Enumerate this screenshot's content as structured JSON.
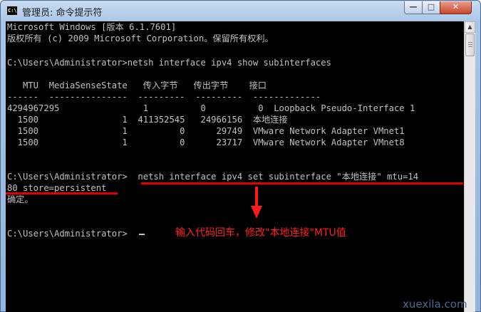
{
  "window": {
    "title": "管理员: 命令提示符",
    "icon_text": "C:\\",
    "controls": {
      "minimize": "—",
      "maximize": "□",
      "close": "✕"
    }
  },
  "console": {
    "lines": [
      "Microsoft Windows [版本 6.1.7601]",
      "版权所有 (c) 2009 Microsoft Corporation。保留所有权利。",
      "",
      "C:\\Users\\Administrator>netsh interface ipv4 show subinterfaces",
      "",
      "   MTU  MediaSenseState   传入字节   传出字节    接口",
      "------  ---------------  ---------  ---------  -------------",
      "4294967295                1          0          0  Loopback Pseudo-Interface 1",
      "  1500                1  411352545   24966156  本地连接",
      "  1500                1          0      29749  VMware Network Adapter VMnet1",
      "  1500                1          0      23717  VMware Network Adapter VMnet8",
      "",
      "",
      "C:\\Users\\Administrator>  netsh interface ipv4 set subinterface \"本地连接\" mtu=14",
      "80 store=persistent",
      "确定。",
      "",
      "",
      "C:\\Users\\Administrator>"
    ]
  },
  "annotation": {
    "text": "输入代码回车，修改\"本地连接\"MTU值",
    "arrow": "down-arrow"
  },
  "watermark": "xuexila.com",
  "colors": {
    "console_bg": "#000000",
    "console_text": "#c0c0c0",
    "highlight": "#e00000"
  }
}
